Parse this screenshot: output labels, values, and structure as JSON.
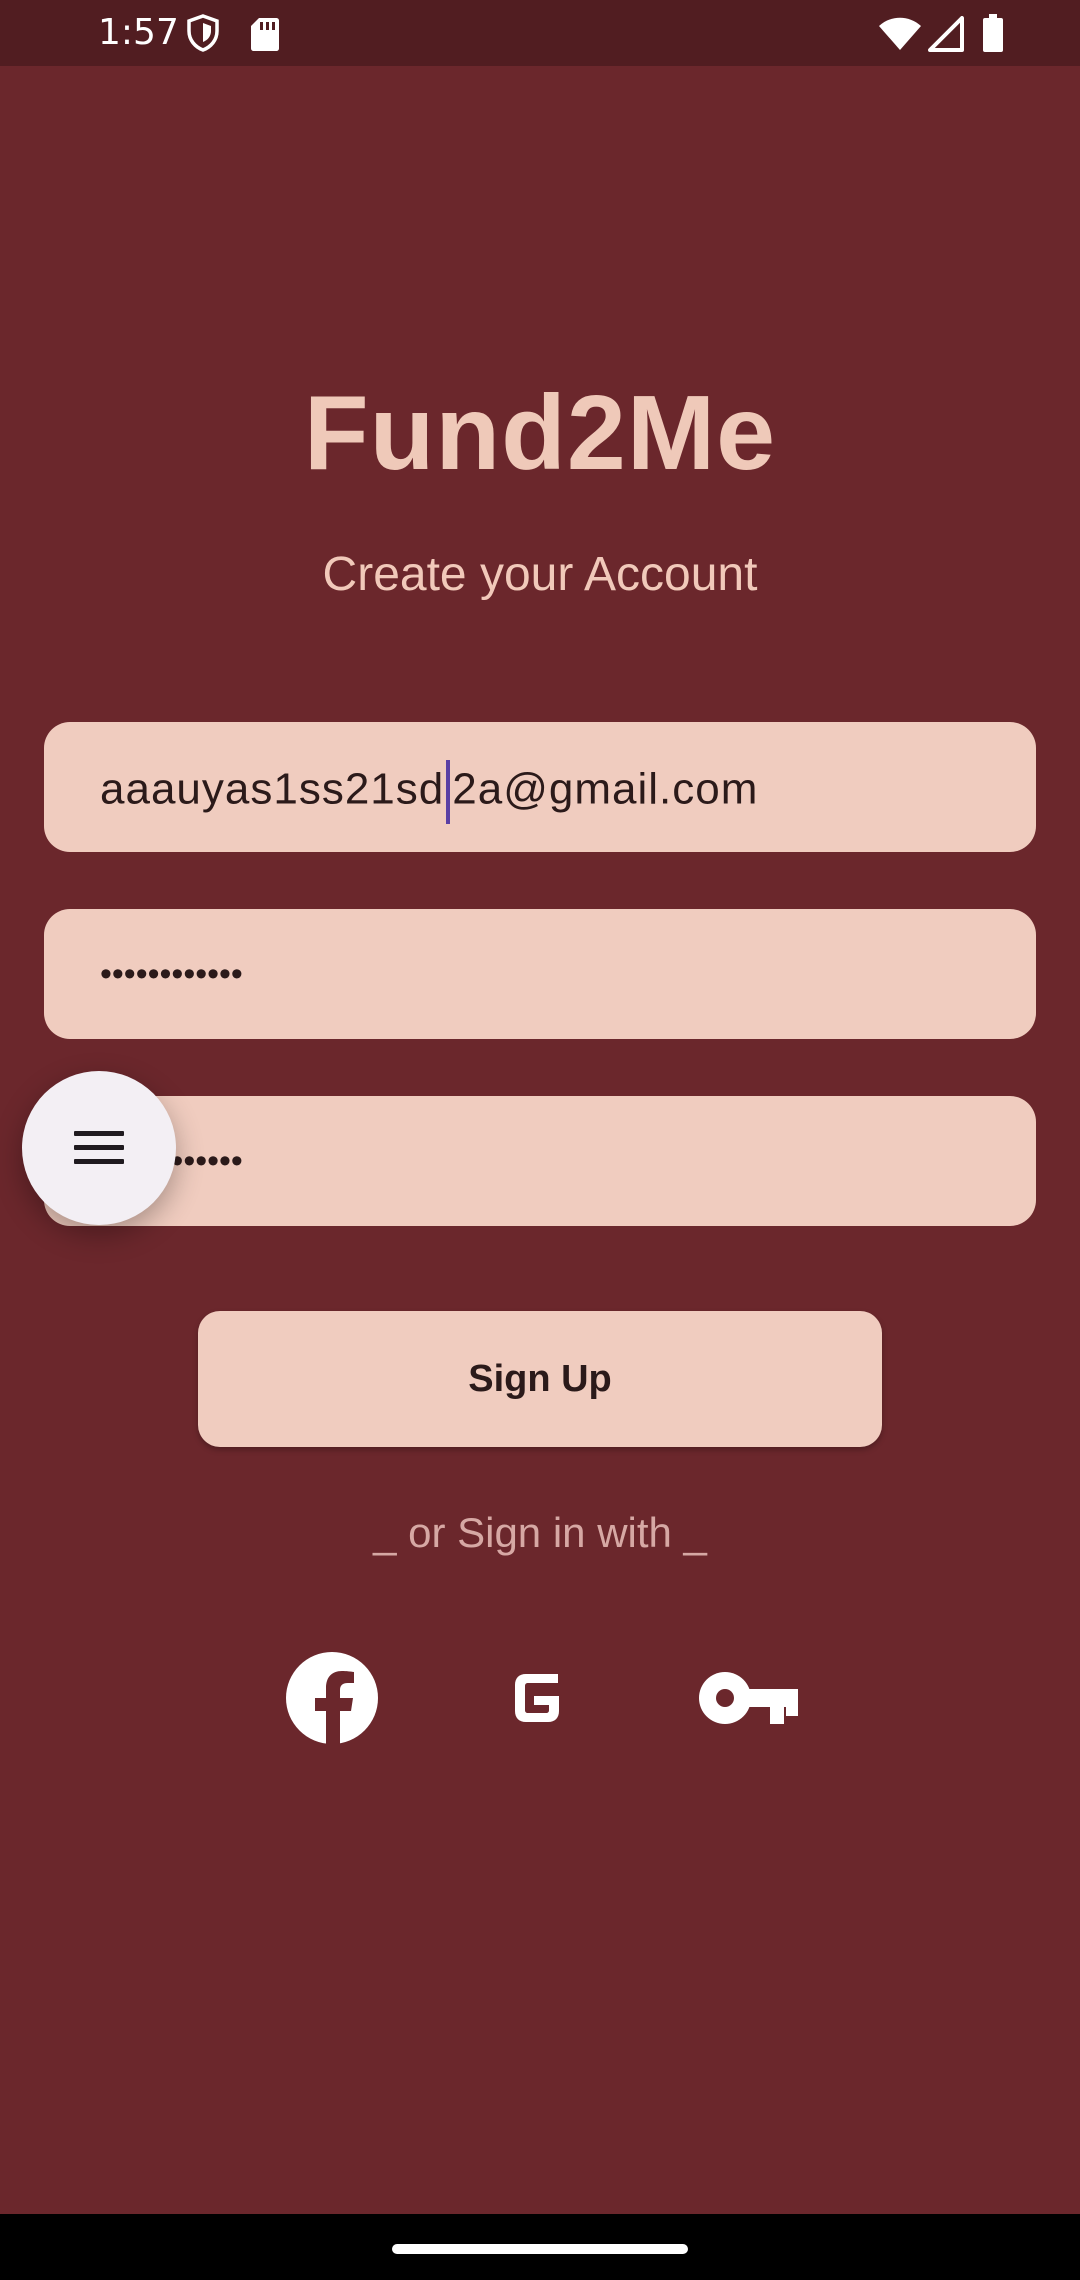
{
  "status_bar": {
    "time": "1:57"
  },
  "app": {
    "title": "Fund2Me",
    "subtitle": "Create your Account"
  },
  "form": {
    "email_before_cursor": "aaauyas1ss21sd",
    "email_after_cursor": "2a@gmail.com",
    "password_dots": "••••••••••••",
    "confirm_password_dots": "••••••••••••"
  },
  "buttons": {
    "signup_label": "Sign Up"
  },
  "social": {
    "divider_text": "_ or Sign in with _",
    "icons": [
      "facebook-icon",
      "google-icon",
      "key-icon"
    ]
  },
  "colors": {
    "background": "#6b272c",
    "status_bar": "#511d21",
    "accent": "#efc9b9",
    "field": "#f0ccbf",
    "fab": "#f3eff4"
  }
}
